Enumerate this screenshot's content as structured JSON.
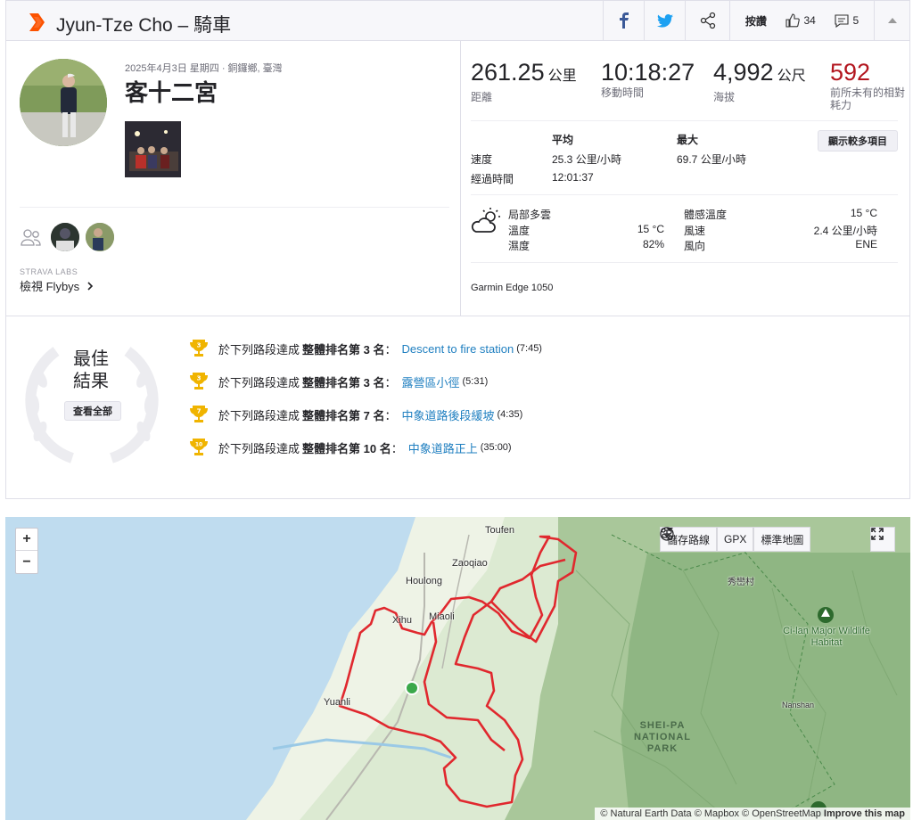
{
  "header": {
    "title": "Jyun-Tze Cho – 騎車",
    "kudos_label": "按讚",
    "kudos_count": "34",
    "comment_count": "5"
  },
  "activity": {
    "date_location": "2025年4月3日 星期四 · 銅鑼鄉, 臺灣",
    "name": "客十二宮"
  },
  "labs": {
    "label": "STRAVA LABS",
    "flybys": "檢視 Flybys"
  },
  "stats": [
    {
      "value": "261.25",
      "unit": "公里",
      "label": "距離"
    },
    {
      "value": "10:18:27",
      "unit": "",
      "label": "移動時間"
    },
    {
      "value": "4,992",
      "unit": "公尺",
      "label": "海拔"
    },
    {
      "value": "592",
      "unit": "",
      "label": "前所未有的相對耗力"
    }
  ],
  "table": {
    "col_avg": "平均",
    "col_max": "最大",
    "more_button": "顯示較多項目",
    "speed_label": "速度",
    "speed_avg": "25.3 公里/小時",
    "speed_max": "69.7 公里/小時",
    "elapsed_label": "經過時間",
    "elapsed_value": "12:01:37"
  },
  "weather": {
    "condition": "局部多雲",
    "temp_label": "溫度",
    "temp_value": "15 °C",
    "humidity_label": "濕度",
    "humidity_value": "82%",
    "feels_label": "體感溫度",
    "feels_value": "15 °C",
    "wind_label": "風速",
    "wind_value": "2.4 公里/小時",
    "dir_label": "風向",
    "dir_value": "ENE"
  },
  "device": "Garmin Edge 1050",
  "best": {
    "title_line1": "最佳",
    "title_line2": "結果",
    "see_all": "查看全部",
    "achievements": [
      {
        "rank_num": "3",
        "prefix": "於下列路段達成",
        "rank": "整體排名第 3 名",
        "segment": "Descent to fire station",
        "time": "(7:45)"
      },
      {
        "rank_num": "3",
        "prefix": "於下列路段達成",
        "rank": "整體排名第 3 名",
        "segment": "露營區小徑",
        "time": "(5:31)"
      },
      {
        "rank_num": "7",
        "prefix": "於下列路段達成",
        "rank": "整體排名第 7 名",
        "segment": "中象道路後段緩坡",
        "time": "(4:35)"
      },
      {
        "rank_num": "10",
        "prefix": "於下列路段達成",
        "rank": "整體排名第 10 名",
        "segment": "中象道路正上",
        "time": "(35:00)"
      }
    ]
  },
  "map": {
    "zoom_in": "+",
    "zoom_out": "−",
    "save_route": "儲存路線",
    "gpx": "GPX",
    "map_type": "標準地圖",
    "cities": [
      "Toufen",
      "Zaoqiao",
      "Houlong",
      "Xihu",
      "Miaoli",
      "Yuanli",
      "秀巒村",
      "Nanshan"
    ],
    "park": "SHEI-PA NATIONAL PARK",
    "poi": "Ci-lan Major Wildlife Habitat",
    "attribution": "© Natural Earth Data © Mapbox © OpenStreetMap",
    "improve": "Improve this map"
  },
  "colors": {
    "brand": "#fc5200",
    "route": "#e0282e",
    "link": "#1f7fc0",
    "effort": "#b3161f",
    "trophy": "#f0b400"
  }
}
